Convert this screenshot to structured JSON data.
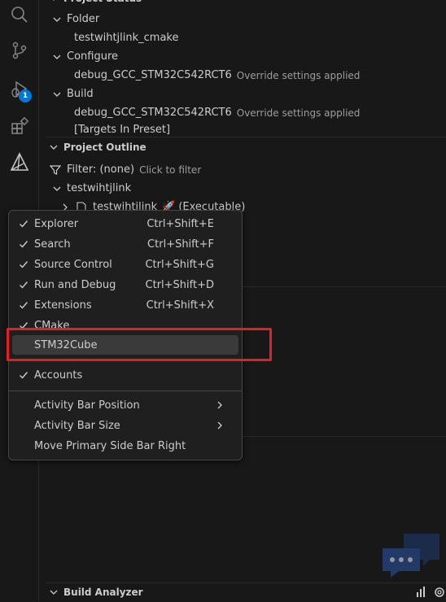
{
  "sidebar": {
    "project_status": {
      "header": "Project Status",
      "folder_label": "Folder",
      "folder_value": "testwihtjlink_cmake",
      "configure_label": "Configure",
      "configure_value": "debug_GCC_STM32C542RCT6",
      "configure_note": "Override settings applied",
      "build_label": "Build",
      "build_value": "debug_GCC_STM32C542RCT6",
      "build_note": "Override settings applied",
      "targets_label": "[Targets In Preset]"
    },
    "project_outline": {
      "header": "Project Outline",
      "filter_label": "Filter: (none)",
      "filter_hint": "Click to filter",
      "project_name": "testwihtjlink",
      "target_name": "testwihtjlink",
      "target_type": "(Executable)"
    },
    "build_analyzer": {
      "header": "Build Analyzer"
    }
  },
  "activity_bar": {
    "debug_badge": "1"
  },
  "context_menu": {
    "items": [
      {
        "label": "Explorer",
        "shortcut": "Ctrl+Shift+E",
        "checked": true
      },
      {
        "label": "Search",
        "shortcut": "Ctrl+Shift+F",
        "checked": true
      },
      {
        "label": "Source Control",
        "shortcut": "Ctrl+Shift+G",
        "checked": true
      },
      {
        "label": "Run and Debug",
        "shortcut": "Ctrl+Shift+D",
        "checked": true
      },
      {
        "label": "Extensions",
        "shortcut": "Ctrl+Shift+X",
        "checked": true
      },
      {
        "label": "CMake",
        "shortcut": "",
        "checked": true
      },
      {
        "label": "STM32Cube",
        "shortcut": "",
        "checked": false
      },
      {
        "label": "Accounts",
        "shortcut": "",
        "checked": true
      },
      {
        "label": "Activity Bar Position",
        "submenu": true
      },
      {
        "label": "Activity Bar Size",
        "submenu": true
      },
      {
        "label": "Move Primary Side Bar Right"
      }
    ]
  },
  "colors": {
    "highlight": "#e31e24",
    "badge": "#0078d4"
  }
}
